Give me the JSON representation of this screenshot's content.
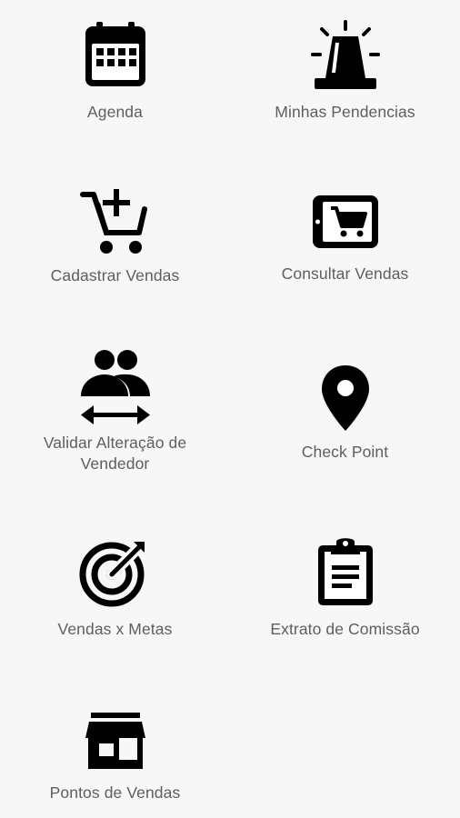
{
  "menu": {
    "items": [
      {
        "id": "agenda",
        "label": "Agenda",
        "icon": "calendar-icon"
      },
      {
        "id": "minhas-pendencias",
        "label": "Minhas Pendencias",
        "icon": "siren-icon"
      },
      {
        "id": "cadastrar-vendas",
        "label": "Cadastrar Vendas",
        "icon": "cart-plus-icon"
      },
      {
        "id": "consultar-vendas",
        "label": "Consultar Vendas",
        "icon": "tablet-cart-icon"
      },
      {
        "id": "validar-alteracao",
        "label_line1": "Validar Alteração de",
        "label_line2": "Vendedor",
        "icon": "people-swap-icon"
      },
      {
        "id": "check-point",
        "label": "Check Point",
        "icon": "map-pin-icon"
      },
      {
        "id": "vendas-x-metas",
        "label": "Vendas x Metas",
        "icon": "target-icon"
      },
      {
        "id": "extrato-comissao",
        "label": "Extrato de Comissão",
        "icon": "clipboard-icon"
      },
      {
        "id": "pontos-de-vendas",
        "label": "Pontos de Vendas",
        "icon": "storefront-icon"
      }
    ]
  },
  "colors": {
    "background": "#f7f7f7",
    "icon": "#000000",
    "label": "#5e5e5e"
  }
}
